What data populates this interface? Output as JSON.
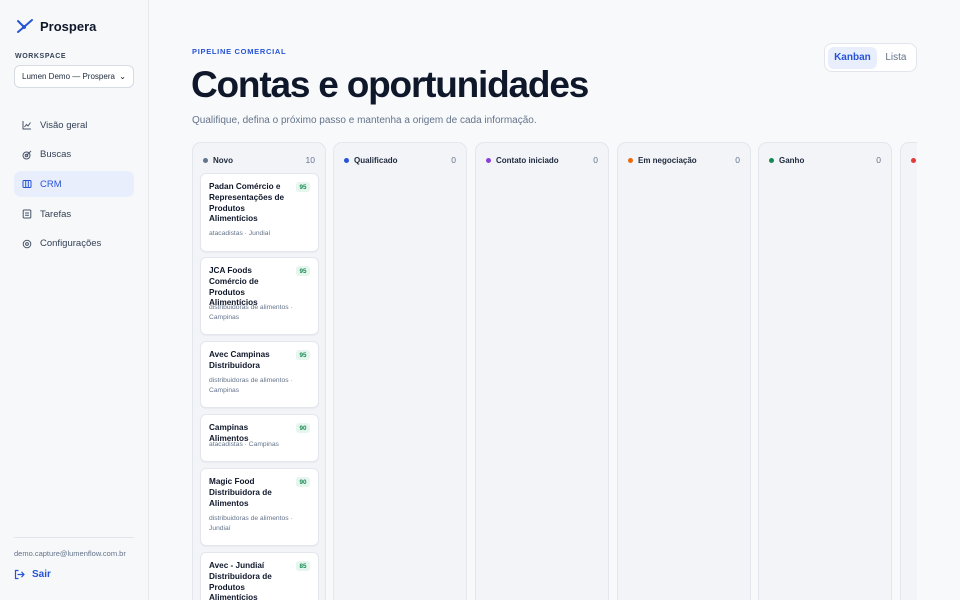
{
  "brand": {
    "name": "Prospera"
  },
  "workspace": {
    "label": "WORKSPACE",
    "selected": "Lumen Demo — Prospera"
  },
  "nav": {
    "items": [
      {
        "label": "Visão geral",
        "icon": "chart-icon"
      },
      {
        "label": "Buscas",
        "icon": "target-icon"
      },
      {
        "label": "CRM",
        "icon": "kanban-icon",
        "active": true
      },
      {
        "label": "Tarefas",
        "icon": "checklist-icon"
      },
      {
        "label": "Configurações",
        "icon": "gear-icon"
      }
    ]
  },
  "footer": {
    "email": "demo.capture@lumenflow.com.br",
    "logout_label": "Sair"
  },
  "header": {
    "eyebrow": "PIPELINE COMERCIAL",
    "title": "Contas e oportunidades",
    "subtitle": "Qualifique, defina o próximo passo e mantenha a origem de cada informação."
  },
  "view_toggle": {
    "kanban_label": "Kanban",
    "list_label": "Lista",
    "selected": "Kanban"
  },
  "colors": {
    "accent": "#2754d6",
    "score_bg": "#e6f6ee",
    "score_text": "#138a52"
  },
  "columns": [
    {
      "name": "Novo",
      "count": "10",
      "color": "#64748b",
      "cards": [
        {
          "title": "Padan Comércio e Representações de Produtos Alimentícios",
          "score": "95",
          "meta": "atacadistas · Jundiaí"
        },
        {
          "title": "JCA Foods Comércio de Produtos Alimentícios",
          "score": "95",
          "meta": "distribuidoras de alimentos · Campinas"
        },
        {
          "title": "Avec Campinas Distribuidora",
          "score": "95",
          "meta": "distribuidoras de alimentos · Campinas"
        },
        {
          "title": "Campinas Alimentos",
          "score": "90",
          "meta": "atacadistas · Campinas"
        },
        {
          "title": "Magic Food Distribuidora de Alimentos",
          "score": "90",
          "meta": "distribuidoras de alimentos · Jundiaí"
        },
        {
          "title": "Avec - Jundiaí Distribuidora de Produtos Alimentícios",
          "score": "85",
          "meta": ""
        }
      ]
    },
    {
      "name": "Qualificado",
      "count": "0",
      "color": "#2754d6",
      "cards": []
    },
    {
      "name": "Contato iniciado",
      "count": "0",
      "color": "#8b3fd9",
      "cards": []
    },
    {
      "name": "Em negociação",
      "count": "0",
      "color": "#ea6a0c",
      "cards": []
    },
    {
      "name": "Ganho",
      "count": "0",
      "color": "#138a52",
      "cards": []
    },
    {
      "name": "",
      "count": "",
      "color": "#e23b3b",
      "cards": []
    }
  ]
}
